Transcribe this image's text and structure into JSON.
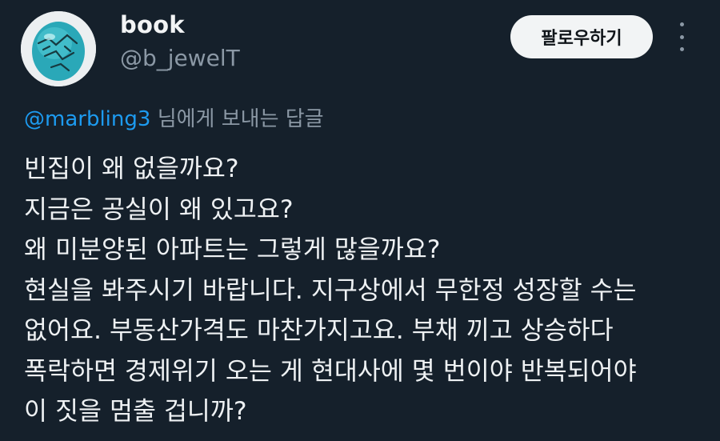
{
  "author": {
    "display_name": "book",
    "handle": "@b_jewelT",
    "avatar_icon": "turquoise-stone-avatar"
  },
  "follow_label": "팔로우하기",
  "more_icon": "more-options-icon",
  "reply_to": {
    "mention": "@marbling3",
    "suffix": "님에게 보내는 답글"
  },
  "tweet_lines": [
    "빈집이 왜 없을까요?",
    "지금은 공실이 왜 있고요?",
    "왜 미분양된 아파트는 그렇게 많을까요?",
    "현실을 봐주시기 바랍니다. 지구상에서 무한정 성장할 수는",
    "없어요. 부동산가격도 마찬가지고요. 부채 끼고 상승하다",
    "폭락하면 경제위기 오는 게 현대사에 몇 번이야 반복되어야",
    "이 짓을 멈출 겁니까?"
  ],
  "colors": {
    "background": "#15202b",
    "mention": "#1d9bf0",
    "secondary_text": "#8b98a5",
    "primary_text": "#e7e9ea",
    "follow_button_bg": "#f2f4f5"
  }
}
